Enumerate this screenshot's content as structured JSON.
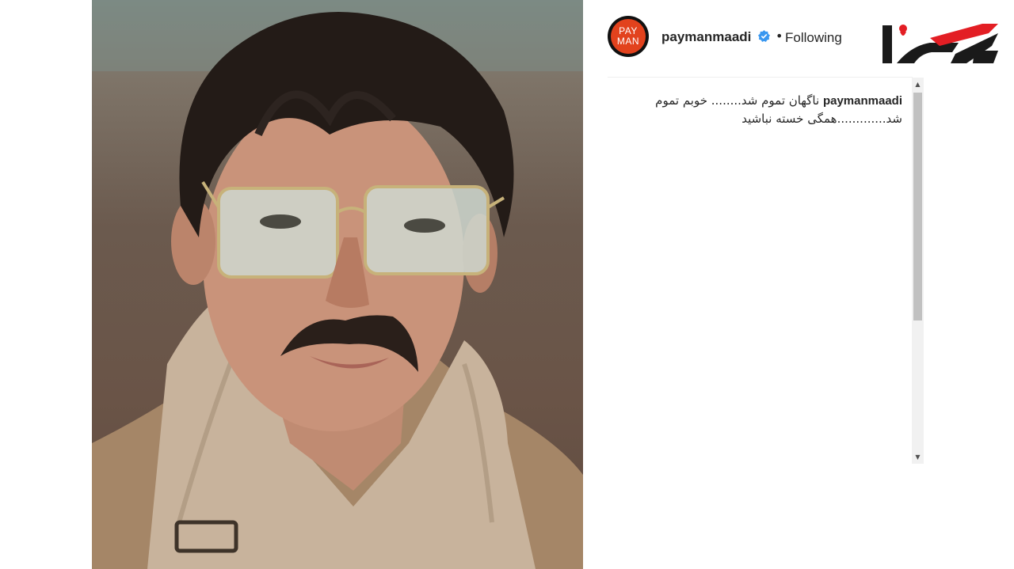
{
  "post": {
    "username": "paymanmaadi",
    "separator": "•",
    "follow_status": "Following",
    "avatar_top": "PAY",
    "avatar_bottom": "MAN"
  },
  "caption": {
    "username": "paymanmaadi",
    "text": "ناگهان تموم شد........ خوبم تموم شد.............همگی خسته نباشید"
  },
  "photo": {
    "subject": "portrait of a man wearing tinted glasses and a shearling jacket"
  },
  "icons": {
    "verified": "verified-badge-icon",
    "scroll_up": "scroll-up-arrow-icon",
    "scroll_down": "scroll-down-arrow-icon",
    "logo": "site-logo-icon"
  },
  "colors": {
    "verified_blue": "#3897f0",
    "logo_red": "#e31e24",
    "logo_dark": "#1a1a1a",
    "avatar_red": "#e2421d"
  }
}
